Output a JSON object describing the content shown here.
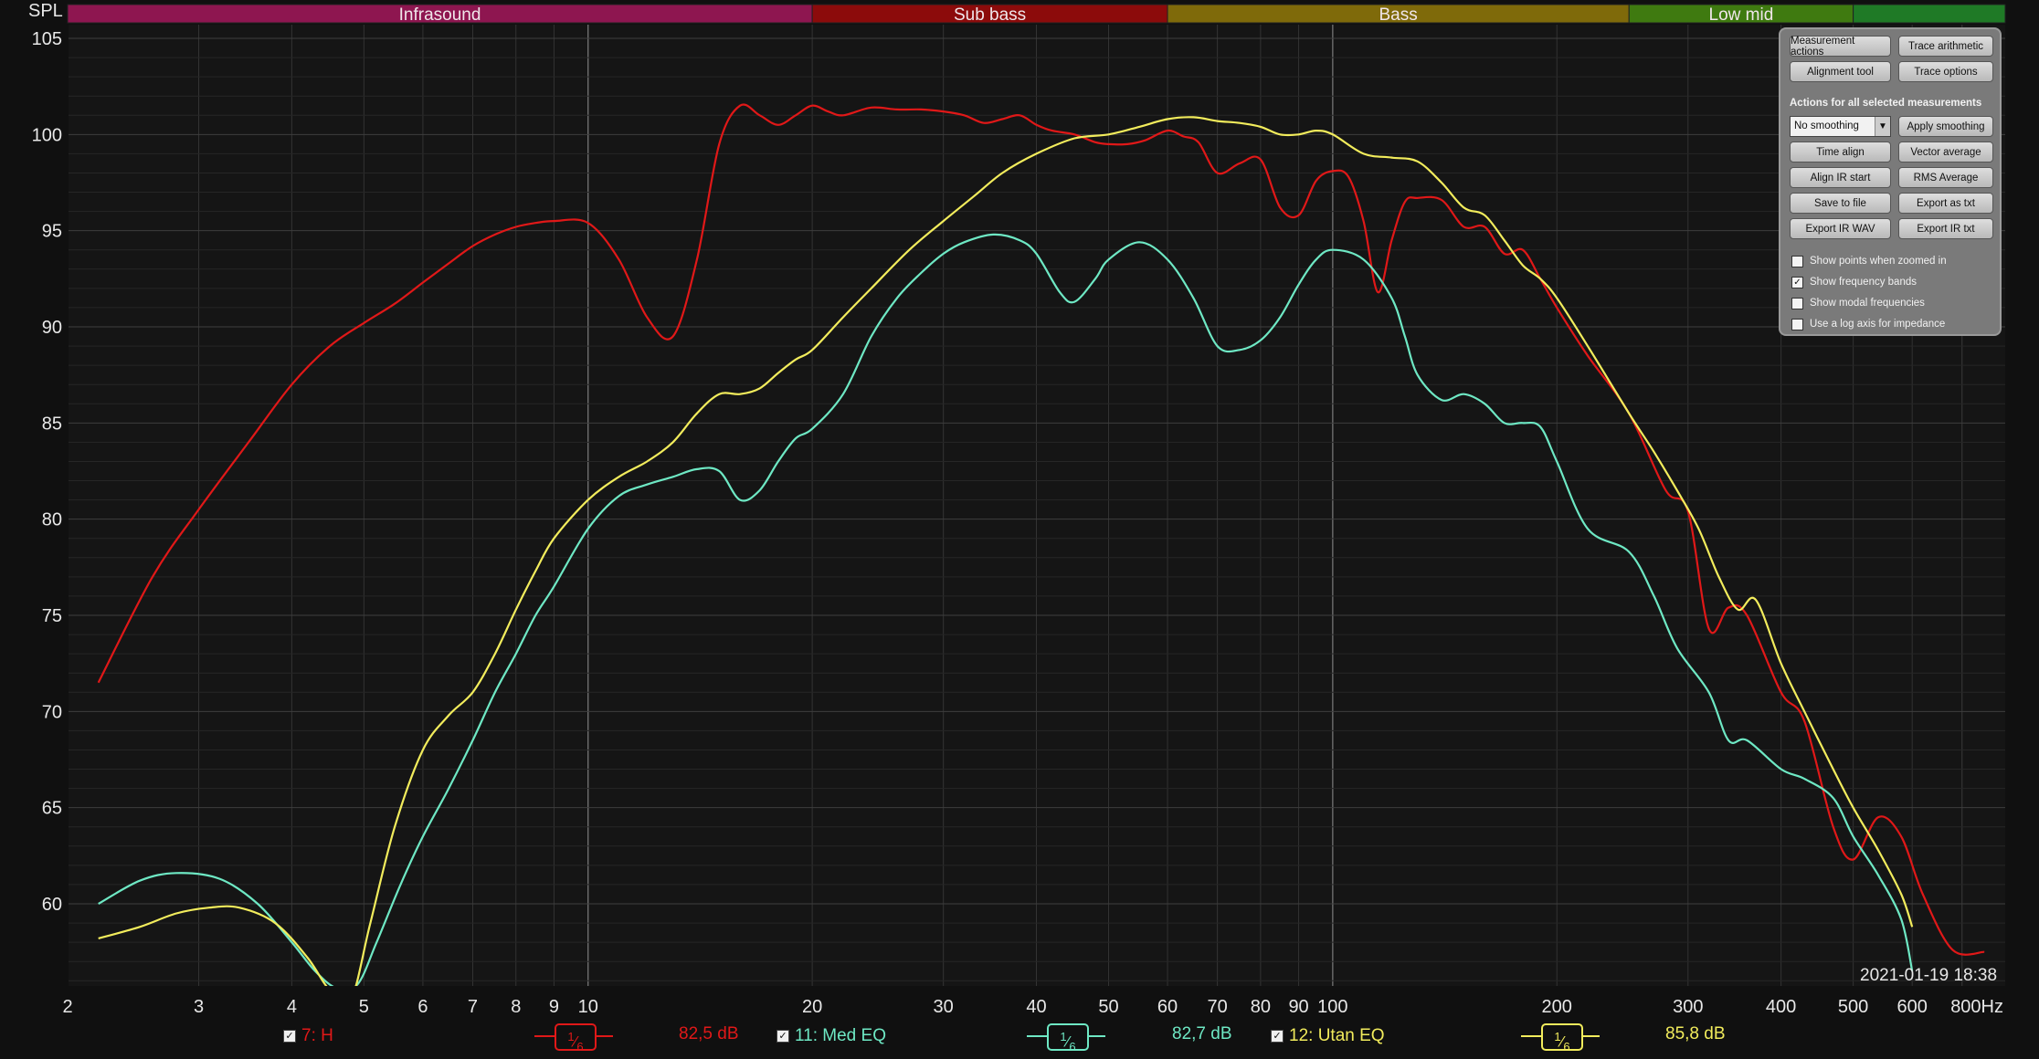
{
  "ylabel": "SPL",
  "x_unit": "Hz",
  "timestamp": "2021-01-19 18:38",
  "bands": [
    {
      "name": "Infrasound",
      "color": "#8e1650"
    },
    {
      "name": "Sub bass",
      "color": "#8c0b0b"
    },
    {
      "name": "Bass",
      "color": "#7f6a0a"
    },
    {
      "name": "Low mid",
      "color": "#3f7a10"
    },
    {
      "name": "",
      "color": "#1f7a26"
    }
  ],
  "panel": {
    "buttons": {
      "measurement_actions": "Measurement actions",
      "trace_arithmetic": "Trace arithmetic",
      "alignment_tool": "Alignment tool",
      "trace_options": "Trace options",
      "apply_smoothing": "Apply smoothing",
      "time_align": "Time align",
      "vector_average": "Vector average",
      "align_ir_start": "Align IR start",
      "rms_average": "RMS Average",
      "save_to_file": "Save to file",
      "export_as_txt": "Export as txt",
      "export_ir_wav": "Export IR WAV",
      "export_ir_txt": "Export IR txt"
    },
    "section_label": "Actions for all selected measurements",
    "smoothing_value": "No smoothing",
    "checkboxes": [
      {
        "label": "Show points when zoomed in",
        "checked": false
      },
      {
        "label": "Show frequency bands",
        "checked": true
      },
      {
        "label": "Show modal frequencies",
        "checked": false
      },
      {
        "label": "Use a log axis for impedance",
        "checked": false
      }
    ]
  },
  "legend": [
    {
      "label": "7: H",
      "smoothing": "1/6",
      "level": "82,5 dB",
      "color": "#e01818",
      "checked": true
    },
    {
      "label": "11: Med EQ",
      "smoothing": "1/6",
      "level": "82,7 dB",
      "color": "#6ee8c4",
      "checked": true
    },
    {
      "label": "12: Utan EQ",
      "smoothing": "1/6",
      "level": "85,8 dB",
      "color": "#f2ec5c",
      "checked": true
    }
  ],
  "chart_data": {
    "type": "line",
    "x_scale": "log",
    "xlim": [
      2,
      800
    ],
    "ylim": [
      55,
      105
    ],
    "ylabel": "SPL",
    "xlabel": "Hz",
    "x_ticks": [
      {
        "value": 2,
        "label": "2"
      },
      {
        "value": 3,
        "label": "3"
      },
      {
        "value": 4,
        "label": "4"
      },
      {
        "value": 5,
        "label": "5"
      },
      {
        "value": 6,
        "label": "6"
      },
      {
        "value": 7,
        "label": "7"
      },
      {
        "value": 8,
        "label": "8"
      },
      {
        "value": 9,
        "label": "9"
      },
      {
        "value": 10,
        "label": "10"
      },
      {
        "value": 20,
        "label": "20"
      },
      {
        "value": 30,
        "label": "30"
      },
      {
        "value": 40,
        "label": "40"
      },
      {
        "value": 50,
        "label": "50"
      },
      {
        "value": 60,
        "label": "60"
      },
      {
        "value": 70,
        "label": "70"
      },
      {
        "value": 80,
        "label": "80"
      },
      {
        "value": 90,
        "label": "90"
      },
      {
        "value": 100,
        "label": "100"
      },
      {
        "value": 200,
        "label": "200"
      },
      {
        "value": 300,
        "label": "300"
      },
      {
        "value": 400,
        "label": "400"
      },
      {
        "value": 500,
        "label": "500"
      },
      {
        "value": 600,
        "label": "600"
      },
      {
        "value": 800,
        "label": "800Hz"
      }
    ],
    "y_ticks": [
      60,
      65,
      70,
      75,
      80,
      85,
      90,
      95,
      100,
      105
    ],
    "grid": true,
    "bands": [
      {
        "name": "Infrasound",
        "from": 2,
        "to": 20
      },
      {
        "name": "Sub bass",
        "from": 20,
        "to": 60
      },
      {
        "name": "Bass",
        "from": 60,
        "to": 250
      },
      {
        "name": "Low mid",
        "from": 250,
        "to": 500
      },
      {
        "name": "",
        "from": 500,
        "to": 800
      }
    ],
    "series": [
      {
        "name": "7: H",
        "color": "#e01818",
        "x": [
          2.2,
          2.6,
          3,
          3.5,
          4,
          4.5,
          5,
          5.5,
          6,
          6.5,
          7,
          7.5,
          8,
          8.5,
          9,
          10,
          11,
          12,
          13,
          14,
          15,
          16,
          17,
          18,
          19,
          20,
          21,
          22,
          24,
          26,
          28,
          30,
          32,
          34,
          36,
          38,
          40,
          42,
          45,
          48,
          50,
          53,
          56,
          60,
          63,
          66,
          70,
          75,
          80,
          85,
          90,
          95,
          100,
          105,
          110,
          115,
          120,
          125,
          130,
          140,
          150,
          160,
          170,
          180,
          190,
          200,
          220,
          250,
          280,
          300,
          320,
          340,
          360,
          400,
          430,
          470,
          500,
          540,
          580,
          620,
          680,
          750
        ],
        "y": [
          71.5,
          77,
          80.5,
          84,
          87,
          89,
          90.2,
          91.2,
          92.3,
          93.3,
          94.2,
          94.8,
          95.2,
          95.4,
          95.5,
          95.4,
          93.5,
          90.5,
          89.5,
          93.5,
          99.5,
          101.5,
          101,
          100.5,
          101,
          101.5,
          101.2,
          101,
          101.4,
          101.3,
          101.3,
          101.2,
          101,
          100.6,
          100.8,
          101,
          100.5,
          100.2,
          100,
          99.6,
          99.5,
          99.5,
          99.7,
          100.2,
          99.9,
          99.6,
          98,
          98.5,
          98.7,
          96.2,
          95.8,
          97.6,
          98.1,
          97.8,
          95.5,
          91.8,
          94.5,
          96.5,
          96.7,
          96.6,
          95.2,
          95.2,
          93.8,
          94,
          92.5,
          91,
          88.5,
          85.5,
          81.5,
          80.4,
          74.3,
          75.4,
          75,
          71,
          69.5,
          64,
          62.3,
          64.5,
          63.5,
          60.5,
          57.6,
          57.5
        ]
      },
      {
        "name": "11: Med EQ",
        "color": "#6ee8c4",
        "x": [
          2.2,
          2.5,
          2.8,
          3.2,
          3.6,
          4,
          4.3,
          4.6,
          4.9,
          5.2,
          5.6,
          6,
          6.5,
          7,
          7.5,
          8,
          8.5,
          9,
          10,
          11,
          12,
          13,
          14,
          15,
          16,
          17,
          18,
          19,
          20,
          22,
          24,
          26,
          28,
          30,
          32,
          35,
          38,
          40,
          43,
          45,
          48,
          50,
          55,
          60,
          65,
          70,
          75,
          80,
          85,
          90,
          95,
          100,
          110,
          120,
          125,
          130,
          140,
          150,
          160,
          170,
          180,
          190,
          200,
          220,
          250,
          270,
          290,
          320,
          340,
          360,
          400,
          430,
          470,
          500,
          540,
          580,
          600
        ],
        "y": [
          60,
          61.2,
          61.6,
          61.3,
          60,
          58,
          56.5,
          55.6,
          55.8,
          58,
          61,
          63.5,
          66,
          68.5,
          71,
          73,
          75,
          76.5,
          79.5,
          81.2,
          81.8,
          82.2,
          82.6,
          82.5,
          81,
          81.5,
          83,
          84.2,
          84.7,
          86.5,
          89.5,
          91.5,
          92.8,
          93.8,
          94.4,
          94.8,
          94.5,
          93.8,
          91.8,
          91.3,
          92.5,
          93.5,
          94.4,
          93.5,
          91.5,
          89,
          88.8,
          89.3,
          90.5,
          92.2,
          93.5,
          94,
          93.5,
          91.5,
          89.5,
          87.5,
          86.2,
          86.5,
          86,
          85,
          85,
          84.8,
          83,
          79.5,
          78.3,
          76,
          73.3,
          71,
          68.5,
          68.5,
          67,
          66.5,
          65.5,
          63.5,
          61.5,
          59.2,
          56.5
        ]
      },
      {
        "name": "12: Utan EQ",
        "color": "#f2ec5c",
        "x": [
          2.2,
          2.5,
          2.8,
          3.1,
          3.4,
          3.8,
          4.2,
          4.5,
          4.8,
          5.1,
          5.5,
          6,
          6.5,
          7,
          7.5,
          8,
          8.5,
          9,
          10,
          11,
          12,
          13,
          14,
          15,
          16,
          17,
          18,
          19,
          20,
          22,
          24,
          27,
          30,
          33,
          36,
          40,
          45,
          50,
          55,
          60,
          65,
          70,
          75,
          80,
          85,
          90,
          95,
          100,
          110,
          120,
          130,
          140,
          150,
          160,
          170,
          180,
          190,
          200,
          220,
          250,
          270,
          290,
          310,
          330,
          350,
          370,
          400,
          430,
          470,
          500,
          540,
          580,
          600
        ],
        "y": [
          58.2,
          58.8,
          59.5,
          59.8,
          59.8,
          59,
          57.2,
          55.5,
          55,
          59,
          64,
          68,
          69.8,
          71,
          73,
          75.3,
          77.3,
          79,
          81,
          82.2,
          83,
          84,
          85.5,
          86.5,
          86.5,
          86.8,
          87.6,
          88.3,
          88.8,
          90.5,
          92,
          94,
          95.5,
          96.8,
          98,
          99,
          99.8,
          100,
          100.4,
          100.8,
          100.9,
          100.7,
          100.6,
          100.4,
          100,
          100,
          100.2,
          100,
          99,
          98.8,
          98.6,
          97.5,
          96.2,
          95.8,
          94.5,
          93.2,
          92.5,
          91.5,
          89,
          85.5,
          83.5,
          81.5,
          79.5,
          77,
          75.3,
          75.8,
          72.5,
          70,
          67,
          65,
          62.8,
          60.5,
          58.8
        ]
      }
    ]
  }
}
